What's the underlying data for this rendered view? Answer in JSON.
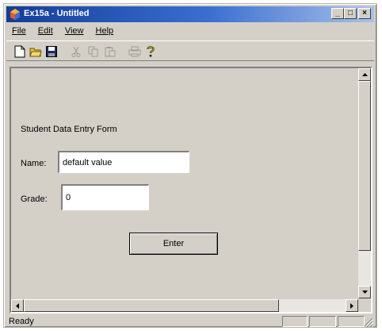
{
  "window": {
    "title": "Ex15a - Untitled",
    "controls": {
      "minimize": "_",
      "maximize": "□",
      "close": "×"
    }
  },
  "menu": {
    "items": [
      "File",
      "Edit",
      "View",
      "Help"
    ]
  },
  "toolbar": {
    "buttons": [
      {
        "icon": "new-document-icon",
        "enabled": true
      },
      {
        "icon": "open-folder-icon",
        "enabled": true
      },
      {
        "icon": "save-disk-icon",
        "enabled": true
      },
      {
        "icon": "cut-icon",
        "enabled": false
      },
      {
        "icon": "copy-icon",
        "enabled": false
      },
      {
        "icon": "paste-icon",
        "enabled": false
      },
      {
        "icon": "print-icon",
        "enabled": false
      },
      {
        "icon": "help-icon",
        "enabled": true
      }
    ]
  },
  "form": {
    "title": "Student Data Entry Form",
    "name_label": "Name:",
    "name_value": "default value",
    "grade_label": "Grade:",
    "grade_value": "0",
    "enter_label": "Enter"
  },
  "status": {
    "text": "Ready"
  },
  "colors": {
    "title_start": "#123d98",
    "title_end": "#a7c0ea",
    "face": "#d4d0c8"
  }
}
